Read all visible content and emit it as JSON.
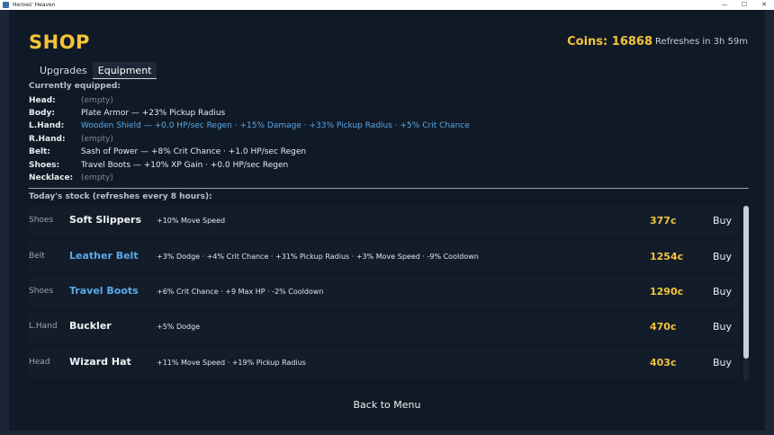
{
  "window": {
    "title": "Heroes' Heaven",
    "minimize": "—",
    "maximize": "☐",
    "close": "✕"
  },
  "header": {
    "title": "SHOP",
    "coins": "Coins: 16868",
    "refresh": "Refreshes in 3h 59m"
  },
  "tabs": [
    {
      "label": "Upgrades"
    },
    {
      "label": "Equipment"
    }
  ],
  "equipped": {
    "header": "Currently equipped:",
    "slots": [
      {
        "slot": "Head:",
        "value": "(empty)"
      },
      {
        "slot": "Body:",
        "value": "Plate Armor — +23% Pickup Radius"
      },
      {
        "slot": "L.Hand:",
        "value": "Wooden Shield — +0.0 HP/sec Regen  ·  +15% Damage  ·  +33% Pickup Radius  ·  +5% Crit Chance"
      },
      {
        "slot": "R.Hand:",
        "value": "(empty)"
      },
      {
        "slot": "Belt:",
        "value": "Sash of Power — +8% Crit Chance  ·  +1.0 HP/sec Regen"
      },
      {
        "slot": "Shoes:",
        "value": "Travel Boots — +10% XP Gain  ·  +0.0 HP/sec Regen"
      },
      {
        "slot": "Necklace:",
        "value": "(empty)"
      }
    ]
  },
  "stock": {
    "header": "Today's stock (refreshes every 8 hours):",
    "items": [
      {
        "category": "Shoes",
        "name": "Soft Slippers",
        "stats": "+10% Move Speed",
        "price": "377c",
        "buy": "Buy"
      },
      {
        "category": "Belt",
        "name": "Leather Belt",
        "stats": "+3% Dodge  ·  +4% Crit Chance  ·  +31% Pickup Radius  ·  +3% Move Speed  ·  -9% Cooldown",
        "price": "1254c",
        "buy": "Buy"
      },
      {
        "category": "Shoes",
        "name": "Travel Boots",
        "stats": "+6% Crit Chance  ·  +9 Max HP  ·  -2% Cooldown",
        "price": "1290c",
        "buy": "Buy"
      },
      {
        "category": "L.Hand",
        "name": "Buckler",
        "stats": "+5% Dodge",
        "price": "470c",
        "buy": "Buy"
      },
      {
        "category": "Head",
        "name": "Wizard Hat",
        "stats": "+11% Move Speed  ·  +19% Pickup Radius",
        "price": "403c",
        "buy": "Buy"
      }
    ]
  },
  "back_label": "Back to Menu",
  "colors": {
    "accent_gold": "#f4c33a",
    "equipped_blue": "#5aa9e8",
    "background": "#101a26"
  }
}
